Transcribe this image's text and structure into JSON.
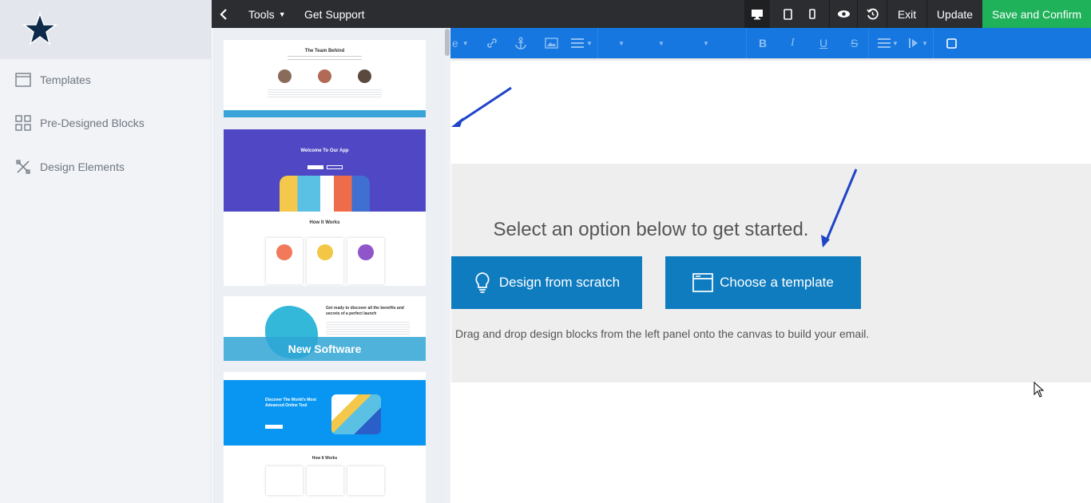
{
  "sidebar": {
    "items": [
      {
        "label": "Templates",
        "icon": "template-icon"
      },
      {
        "label": "Pre-Designed Blocks",
        "icon": "grid-blocks-icon"
      },
      {
        "label": "Design Elements",
        "icon": "design-tools-icon"
      }
    ]
  },
  "topbar": {
    "tools_label": "Tools",
    "support_label": "Get Support",
    "exit_label": "Exit",
    "update_label": "Update",
    "save_label": "Save and Confirm"
  },
  "thumbnails": {
    "team": {
      "title": "The Team Behind"
    },
    "app": {
      "title": "Welcome To Our App",
      "section": "How It Works"
    },
    "software": {
      "title": "Get ready to discover all the benefits and secrets of a perfect launch",
      "overlay": "New Software"
    },
    "tool": {
      "title": "Discover The World's Most Advanced Online Tool",
      "section": "How It Works"
    }
  },
  "canvas": {
    "headline": "Select an option below to get started.",
    "scratch_label": "Design from scratch",
    "template_label": "Choose a template",
    "drag_text": "Drag and drop design blocks from the left panel onto the canvas to build your email."
  },
  "colors": {
    "topbar": "#2b2d30",
    "save": "#1fb25a",
    "toolbar": "#1677e0",
    "cta": "#0f7cc0",
    "arrow": "#1f44c8"
  }
}
